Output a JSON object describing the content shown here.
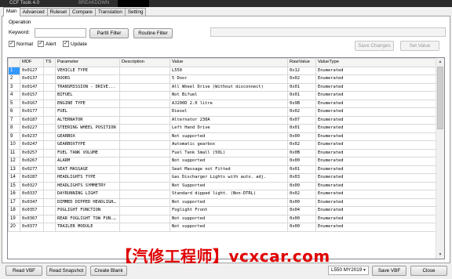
{
  "titlebar": {
    "title": "CCF Tools 4.0",
    "subtitle": "BREAKDOWN"
  },
  "tabs": [
    {
      "label": "Main",
      "active": true
    },
    {
      "label": "Advanced",
      "active": false
    },
    {
      "label": "Ruleset",
      "active": false
    },
    {
      "label": "Compare",
      "active": false
    },
    {
      "label": "Translation",
      "active": false
    },
    {
      "label": "Setting",
      "active": false
    }
  ],
  "operation": {
    "section_label": "Operation",
    "keyword_label": "Keyword:",
    "keyword_value": "",
    "partial_filter": "PartII Filter",
    "routine_filter": "Routine Filter",
    "checkboxes": {
      "normal": "Normal",
      "alert": "Alert",
      "update": "Update"
    },
    "save_changes": "Save Changes",
    "set_value": "Set Value"
  },
  "grid": {
    "columns": [
      "",
      "MDF",
      "TS",
      "Parameter",
      "Description",
      "Value",
      "RawValue",
      "ValueType"
    ],
    "rows": [
      [
        "1",
        "0x0127",
        "",
        "VEHICLE TYPE",
        "",
        "L550",
        "0x12",
        "Enumerated"
      ],
      [
        "2",
        "0x0137",
        "",
        "DOORS",
        "",
        "5 Door",
        "0x02",
        "Enumerated"
      ],
      [
        "3",
        "0x0147",
        "",
        "TRANSMISSION - DRIVE...",
        "",
        "All Wheel Drive (Without disconnect)",
        "0x01",
        "Enumerated"
      ],
      [
        "4",
        "0x0157",
        "",
        "BIFUEL",
        "",
        "Not Bifuel",
        "0x01",
        "Enumerated"
      ],
      [
        "5",
        "0x0167",
        "",
        "ENGINE TYPE",
        "",
        "AJ200D 2.0 litre",
        "0x9B",
        "Enumerated"
      ],
      [
        "6",
        "0x0177",
        "",
        "FUEL",
        "",
        "Diesel",
        "0x02",
        "Enumerated"
      ],
      [
        "7",
        "0x0187",
        "",
        "ALTERNATOR",
        "",
        "Alternator 230A",
        "0x07",
        "Enumerated"
      ],
      [
        "8",
        "0x0227",
        "",
        "STEERING WHEEL POSITION",
        "",
        "Left Hand Drive",
        "0x01",
        "Enumerated"
      ],
      [
        "9",
        "0x0237",
        "",
        "GEARBOX",
        "",
        "Not supported",
        "0x00",
        "Enumerated"
      ],
      [
        "10",
        "0x0247",
        "",
        "GEARBOXTYPE",
        "",
        "Automatic gearbox",
        "0x02",
        "Enumerated"
      ],
      [
        "11",
        "0x0257",
        "",
        "FUEL TANK VOLUME",
        "",
        "Fuel Tank Small (50L)",
        "0x0B",
        "Enumerated"
      ],
      [
        "12",
        "0x0267",
        "",
        "ALARM",
        "",
        "Not supported",
        "0x00",
        "Enumerated"
      ],
      [
        "13",
        "0x0277",
        "",
        "SEAT MASSAGE",
        "",
        "Seat Massage not Fitted",
        "0x01",
        "Enumerated"
      ],
      [
        "14",
        "0x0287",
        "",
        "HEADLIGHTS TYPE",
        "",
        "Gas Discharger Lights with auto. adj.",
        "0x03",
        "Enumerated"
      ],
      [
        "15",
        "0x0327",
        "",
        "HEADLIGHTS SYMMETRY",
        "",
        "Not Supported",
        "0x00",
        "Enumerated"
      ],
      [
        "16",
        "0x0337",
        "",
        "DAYRUNNING LIGHT",
        "",
        "Standard dipped light. (Non-DTRL)",
        "0x02",
        "Enumerated"
      ],
      [
        "17",
        "0x0347",
        "",
        "DIMMED DIPPED HEADLIGHTS",
        "",
        "Not supported",
        "0x00",
        "Enumerated"
      ],
      [
        "18",
        "0x0357",
        "",
        "FOGLIGHT FUNCTION",
        "",
        "Foglight Front",
        "0x04",
        "Enumerated"
      ],
      [
        "19",
        "0x0367",
        "",
        "REAR FOGLIGHT TOW FUN...",
        "",
        "Not supported",
        "0x00",
        "Enumerated"
      ],
      [
        "20",
        "0x0377",
        "",
        "TRAILER MODULE",
        "",
        "Not supported",
        "0x00",
        "Enumerated"
      ]
    ]
  },
  "bottom": {
    "read_vbf": "Read VBF",
    "read_snapshot": "Read Snapshot",
    "create_blank": "Create Blank",
    "model_select": "L550 MY2019",
    "save_vbf": "Save VBF",
    "close": "Close"
  },
  "watermark": "【汽修工程师】vcxcar.com"
}
